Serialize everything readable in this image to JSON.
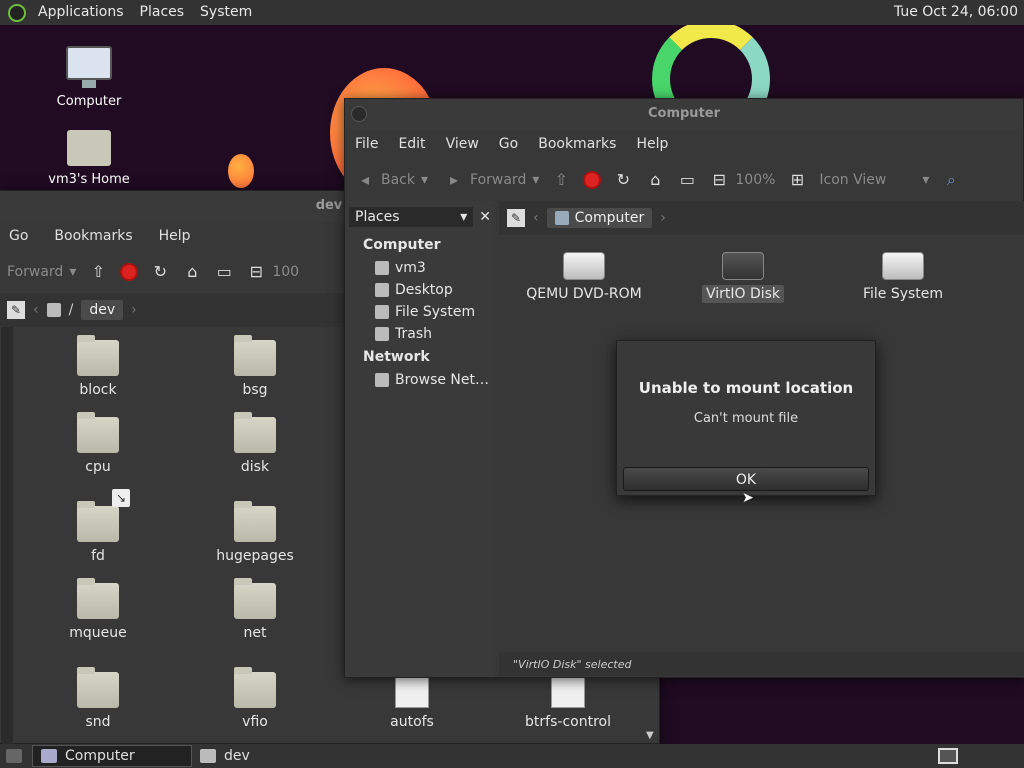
{
  "top_panel": {
    "menus": [
      "Applications",
      "Places",
      "System"
    ],
    "clock": "Tue Oct 24, 06:00"
  },
  "desktop": {
    "icons": [
      {
        "label": "Computer"
      },
      {
        "label": "vm3's Home"
      }
    ]
  },
  "dev_window": {
    "title": "dev",
    "menus": [
      "Go",
      "Bookmarks",
      "Help"
    ],
    "toolbar": {
      "forward": "Forward",
      "zoom": "100"
    },
    "path": [
      "/",
      "dev"
    ],
    "items": [
      {
        "label": "block"
      },
      {
        "label": "bsg"
      },
      {
        "label": "cpu"
      },
      {
        "label": "disk"
      },
      {
        "label": "fd"
      },
      {
        "label": "hugepages"
      },
      {
        "label": "mqueue"
      },
      {
        "label": "net"
      },
      {
        "label": "snd"
      },
      {
        "label": "vfio"
      },
      {
        "label": "autofs"
      },
      {
        "label": "btrfs-control"
      }
    ]
  },
  "computer_window": {
    "title": "Computer",
    "menus": [
      "File",
      "Edit",
      "View",
      "Go",
      "Bookmarks",
      "Help"
    ],
    "toolbar": {
      "back": "Back",
      "forward": "Forward",
      "zoom": "100%",
      "view": "Icon View"
    },
    "sidebar": {
      "selector": "Places",
      "sections": [
        {
          "header": "Computer",
          "items": [
            "vm3",
            "Desktop",
            "File System",
            "Trash"
          ]
        },
        {
          "header": "Network",
          "items": [
            "Browse Net…"
          ]
        }
      ]
    },
    "path": [
      "Computer"
    ],
    "drives": [
      {
        "label": "QEMU DVD-ROM"
      },
      {
        "label": "VirtIO Disk"
      },
      {
        "label": "File System"
      }
    ],
    "status": "\"VirtIO Disk\" selected"
  },
  "dialog": {
    "title": "Unable to mount location",
    "message": "Can't mount file",
    "ok": "OK"
  },
  "taskbar": {
    "tasks": [
      "Computer",
      "dev"
    ]
  }
}
